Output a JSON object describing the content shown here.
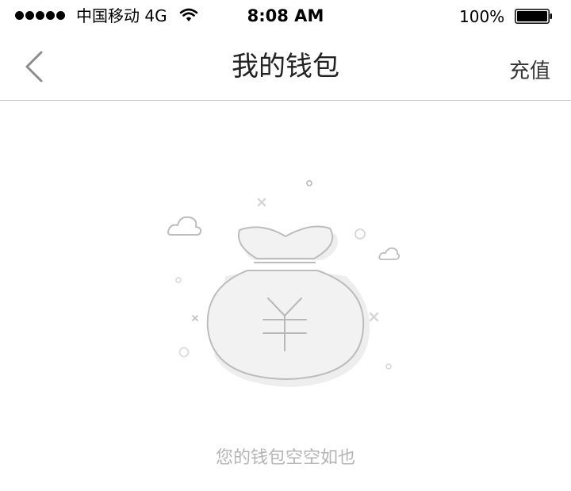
{
  "status_bar": {
    "carrier": "中国移动 4G",
    "time": "8:08 AM",
    "battery_percent": "100%",
    "signal_icon": "signal-dots-icon",
    "wifi_icon": "wifi-icon",
    "battery_icon": "battery-icon"
  },
  "nav": {
    "title": "我的钱包",
    "back_icon": "chevron-left-icon",
    "recharge_label": "充值"
  },
  "main": {
    "illustration_icon": "money-bag-icon",
    "bag_symbol": "¥",
    "empty_message": "您的钱包空空如也"
  },
  "colors": {
    "text_primary": "#222222",
    "text_muted": "#b4b4b4",
    "divider": "#c8c8c8",
    "illustration_fill": "#eeeeee",
    "illustration_stroke": "#bdbdbd"
  }
}
